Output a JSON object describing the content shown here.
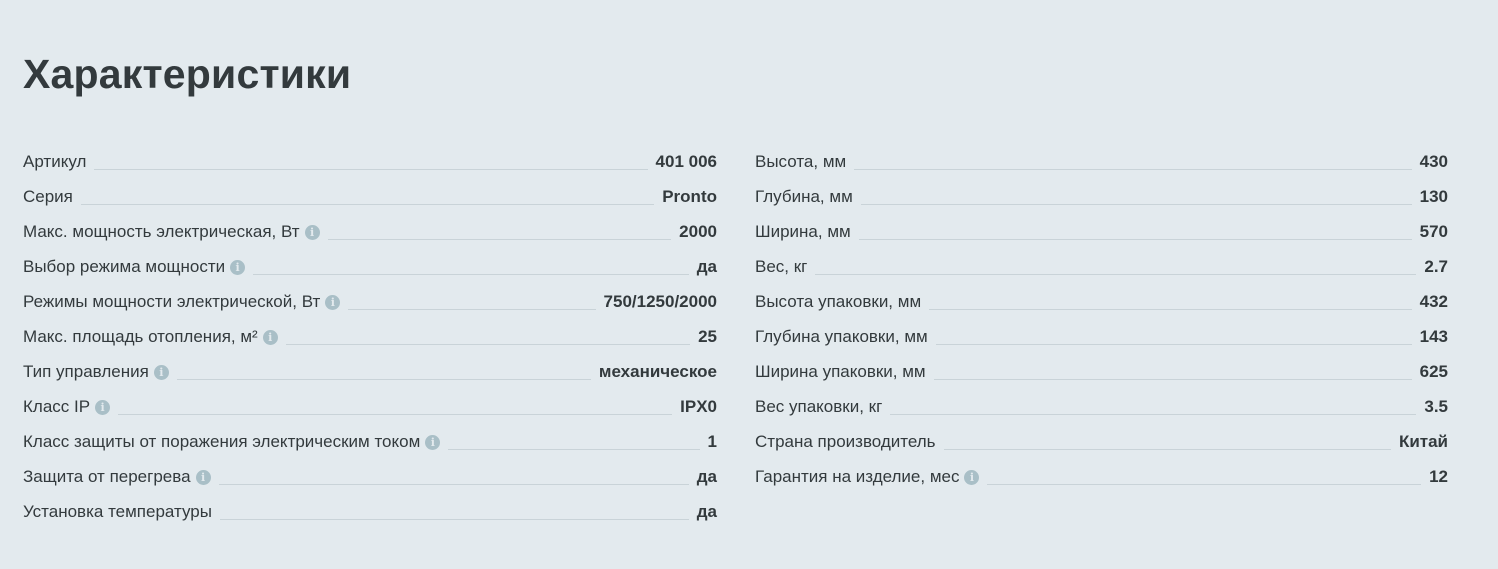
{
  "title": "Характеристики",
  "left": [
    {
      "label": "Артикул",
      "value": "401 006",
      "info": false
    },
    {
      "label": "Серия",
      "value": "Pronto",
      "info": false
    },
    {
      "label": "Макс. мощность электрическая, Вт",
      "value": "2000",
      "info": true
    },
    {
      "label": "Выбор режима мощности",
      "value": "да",
      "info": true
    },
    {
      "label": "Режимы мощности электрической, Вт",
      "value": "750/1250/2000",
      "info": true
    },
    {
      "label": "Макс. площадь отопления, м²",
      "value": "25",
      "info": true
    },
    {
      "label": "Тип управления",
      "value": "механическое",
      "info": true
    },
    {
      "label": "Класс IP",
      "value": "IPX0",
      "info": true
    },
    {
      "label": "Класс защиты от поражения электрическим током",
      "value": "1",
      "info": true
    },
    {
      "label": "Защита от перегрева",
      "value": "да",
      "info": true
    },
    {
      "label": "Установка температуры",
      "value": "да",
      "info": false
    }
  ],
  "right": [
    {
      "label": "Высота, мм",
      "value": "430",
      "info": false
    },
    {
      "label": "Глубина, мм",
      "value": "130",
      "info": false
    },
    {
      "label": "Ширина, мм",
      "value": "570",
      "info": false
    },
    {
      "label": "Вес, кг",
      "value": "2.7",
      "info": false
    },
    {
      "label": "Высота упаковки, мм",
      "value": "432",
      "info": false
    },
    {
      "label": "Глубина упаковки, мм",
      "value": "143",
      "info": false
    },
    {
      "label": "Ширина упаковки, мм",
      "value": "625",
      "info": false
    },
    {
      "label": "Вес упаковки, кг",
      "value": "3.5",
      "info": false
    },
    {
      "label": "Страна производитель",
      "value": "Китай",
      "info": false
    },
    {
      "label": "Гарантия на изделие, мес",
      "value": "12",
      "info": true
    }
  ],
  "info_icon": {
    "name": "info-icon",
    "glyph": "i"
  },
  "colors": {
    "background": "#e3eaee",
    "text": "#333a3d",
    "leader": "#c9d3d8",
    "info_icon": "#a9bfc7"
  }
}
